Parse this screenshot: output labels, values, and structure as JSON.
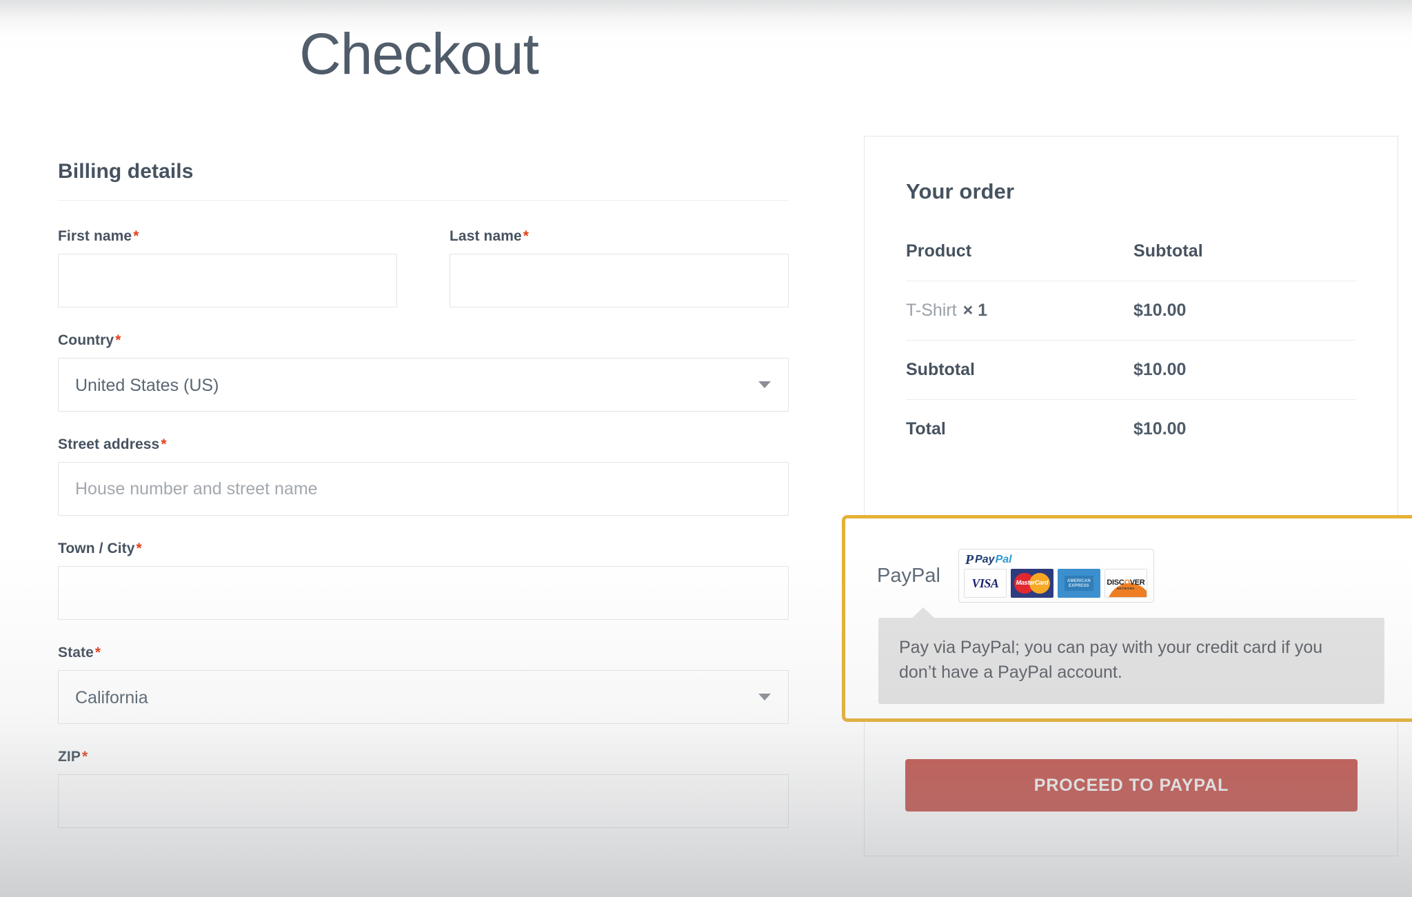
{
  "page": {
    "title": "Checkout"
  },
  "billing": {
    "heading": "Billing details",
    "required_marker": "*",
    "fields": {
      "first_name": {
        "label": "First name",
        "value": "",
        "placeholder": ""
      },
      "last_name": {
        "label": "Last name",
        "value": "",
        "placeholder": ""
      },
      "country": {
        "label": "Country",
        "value": "United States (US)"
      },
      "street": {
        "label": "Street address",
        "value": "",
        "placeholder": "House number and street name"
      },
      "city": {
        "label": "Town / City",
        "value": "",
        "placeholder": ""
      },
      "state": {
        "label": "State",
        "value": "California"
      },
      "zip": {
        "label": "ZIP",
        "value": "",
        "placeholder": ""
      }
    }
  },
  "order": {
    "heading": "Your order",
    "columns": {
      "product": "Product",
      "subtotal": "Subtotal"
    },
    "items": [
      {
        "name": "T-Shirt",
        "qty": "× 1",
        "amount": "$10.00"
      }
    ],
    "subtotal_label": "Subtotal",
    "subtotal_amount": "$10.00",
    "total_label": "Total",
    "total_amount": "$10.00"
  },
  "payment": {
    "method_label": "PayPal",
    "acceptance_mark": {
      "brand_p": "P",
      "brand_pay": "Pay",
      "brand_pal": "Pal",
      "cards": [
        "VISA",
        "MasterCard",
        "AMERICAN EXPRESS",
        "DISCOVER NETWORK"
      ]
    },
    "tooltip": "Pay via PayPal; you can pay with your credit card if you don’t have a PayPal account.",
    "submit_label": "PROCEED TO PAYPAL",
    "highlight_color": "#e5b137",
    "button_color": "#c4564f"
  }
}
